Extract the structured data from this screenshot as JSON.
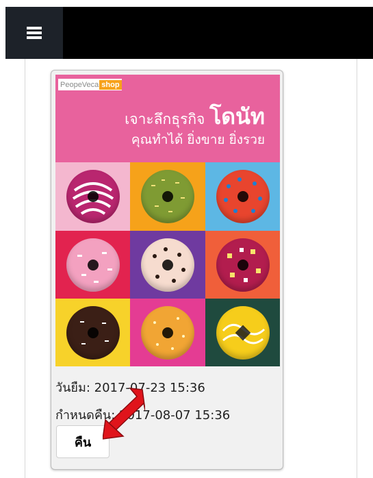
{
  "header": {
    "menu_icon": "hamburger-menu-icon"
  },
  "book": {
    "cover": {
      "brand_text": "PeopeVeca",
      "brand_highlight": "shop",
      "title_line1_prefix": "เจาะลึกธุรกิจ",
      "title_line1_big": "โดนัท",
      "title_line2": "คุณทำได้ ยิ่งขาย ยิ่งรวย",
      "colors": {
        "header_bg": "#e8629d"
      }
    },
    "borrow_label": "วันยืม:",
    "borrow_value": "2017-07-23 15:36",
    "due_label": "กำหนดคืน:",
    "due_value": "2017-08-07 15:36",
    "return_button": "คืน"
  },
  "annotation": {
    "arrow_color": "#e0141b",
    "arrow_target": "return-button"
  }
}
